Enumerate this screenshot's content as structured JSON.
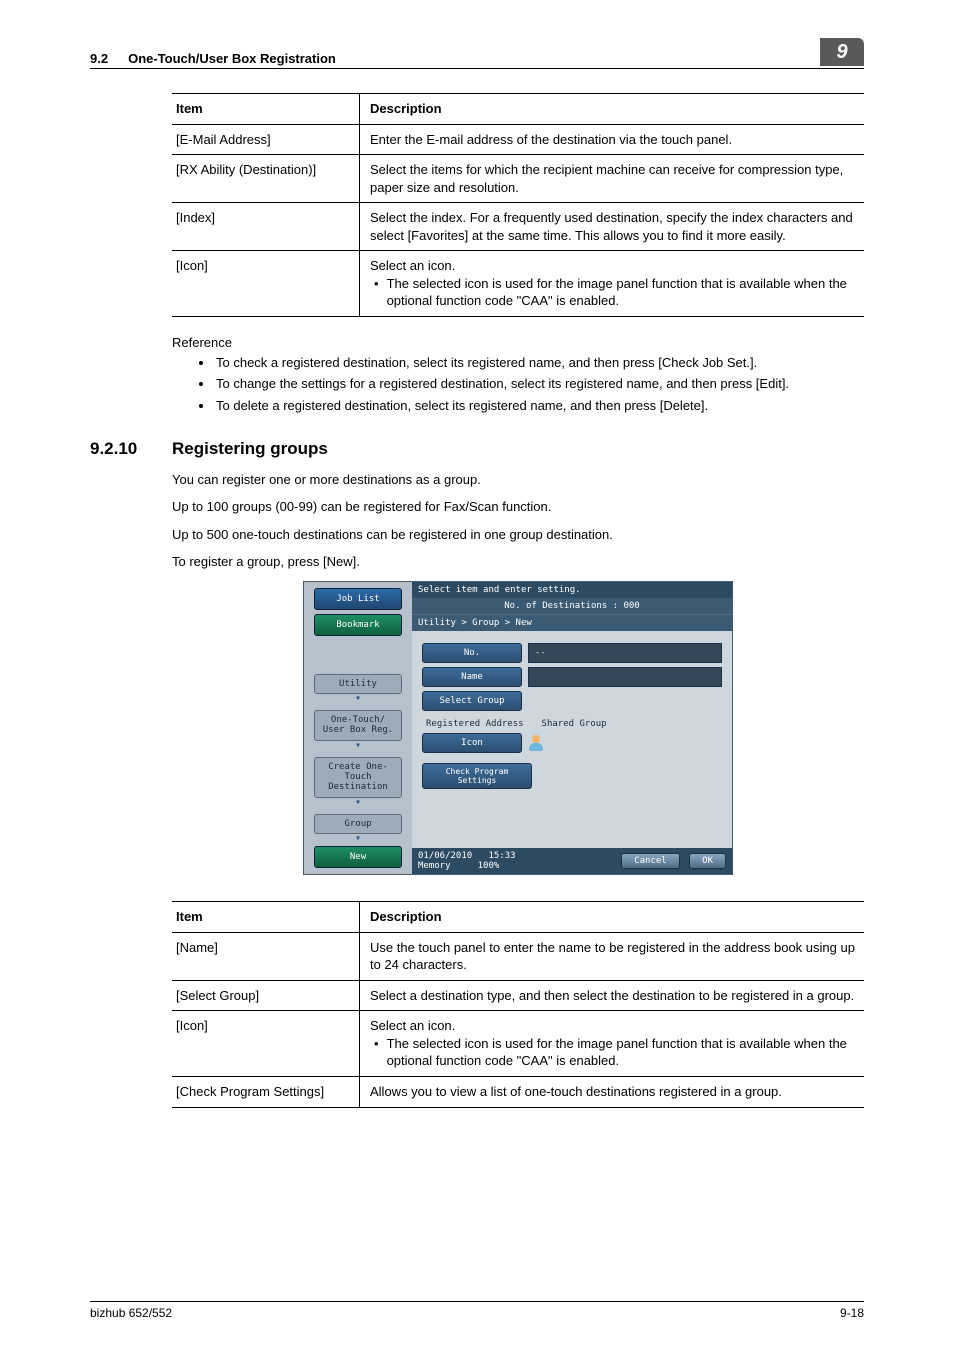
{
  "header": {
    "section_no": "9.2",
    "section_title": "One-Touch/User Box Registration",
    "chapter": "9"
  },
  "table1": {
    "head_item": "Item",
    "head_desc": "Description",
    "rows": [
      {
        "item": "[E-Mail Address]",
        "desc": "Enter the E-mail address of the destination via the touch panel."
      },
      {
        "item": "[RX Ability (Destination)]",
        "desc": "Select the items for which the recipient machine can receive for compression type, paper size and resolution."
      },
      {
        "item": "[Index]",
        "desc": "Select the index. For a frequently used destination, specify the index characters and select [Favorites] at the same time. This allows you to find it more easily."
      },
      {
        "item": "[Icon]",
        "desc": "Select an icon.",
        "sub": "The selected icon is used for the image panel function that is available when the optional function code \"CAA\" is enabled."
      }
    ]
  },
  "reference": {
    "label": "Reference",
    "items": [
      "To check a registered destination, select its registered name, and then press [Check Job Set.].",
      "To change the settings for a registered destination, select its registered name, and then press [Edit].",
      "To delete a registered destination, select its registered name, and then press [Delete]."
    ]
  },
  "section": {
    "num": "9.2.10",
    "title": "Registering groups",
    "p1": "You can register one or more destinations as a group.",
    "p2": "Up to 100 groups (00-99) can be registered for Fax/Scan function.",
    "p3": "Up to 500 one-touch destinations can be registered in one group destination.",
    "p4": "To register a group, press [New]."
  },
  "screenshot": {
    "side": {
      "job_list": "Job List",
      "bookmark": "Bookmark",
      "utility": "Utility",
      "one_touch": "One-Touch/\nUser Box Reg.",
      "create": "Create One-Touch\nDestination",
      "group": "Group",
      "new": "New"
    },
    "top": "Select item and enter setting.",
    "dest_line": "No. of Destinations :   000",
    "breadcrumb": "Utility > Group > New",
    "fields": {
      "no": "No.",
      "no_val": "--",
      "name": "Name",
      "select_group": "Select Group",
      "reg_addr": "Registered Address",
      "shared": "Shared Group",
      "icon": "Icon",
      "check_prog": "Check Program\nSettings"
    },
    "foot": {
      "date": "01/06/2010",
      "time": "15:33",
      "mem": "Memory",
      "pct": "100%",
      "cancel": "Cancel",
      "ok": "OK"
    }
  },
  "table2": {
    "head_item": "Item",
    "head_desc": "Description",
    "rows": [
      {
        "item": "[Name]",
        "desc": "Use the touch panel to enter the name to be registered in the address book using up to 24 characters."
      },
      {
        "item": "[Select Group]",
        "desc": "Select a destination type, and then select the destination to be registered in a group."
      },
      {
        "item": "[Icon]",
        "desc": "Select an icon.",
        "sub": "The selected icon is used for the image panel function that is available when the optional function code \"CAA\" is enabled."
      },
      {
        "item": "[Check Program Settings]",
        "desc": "Allows you to view a list of one-touch destinations registered in a group."
      }
    ]
  },
  "footer": {
    "model": "bizhub 652/552",
    "page": "9-18"
  }
}
